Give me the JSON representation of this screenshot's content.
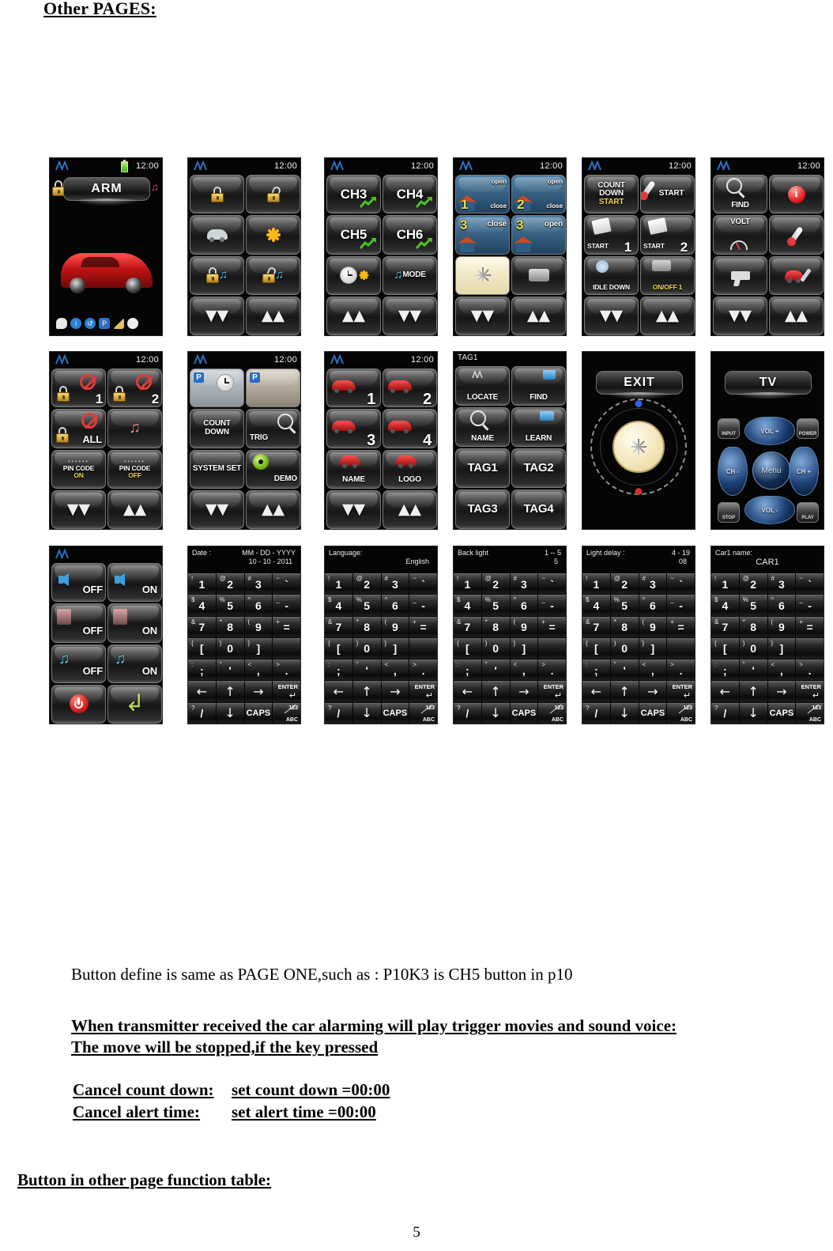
{
  "page": {
    "title": "Other PAGES:",
    "number": "5",
    "note_plain": "Button define is same as PAGE ONE,such as : P10K3 is CH5 button in p10",
    "bold_lines": [
      "When transmitter received the car alarming will play trigger movies and sound voice:",
      "The move will be stopped,if the key pressed"
    ],
    "cancel_rows": [
      {
        "left": "Cancel  count down:",
        "right": "set count down =00:00"
      },
      {
        "left": "Cancel  alert time:",
        "right": "set alert time  =00:00"
      }
    ],
    "footer_heading": "Button in other page function table:"
  },
  "common": {
    "clock": "12:00",
    "down_chevron": "❯",
    "up_chevron": "❮"
  },
  "screens": [
    {
      "id": "arm-home",
      "type": "home",
      "status": {
        "clock": "12:00",
        "battery": true,
        "signal": "signal-icon"
      },
      "banner": "ARM",
      "left_icon": "padlock-closed-icon",
      "right_icon": "music-note-icon",
      "car_image": "red-sports-car",
      "tray_icons": [
        "message-icon",
        "info-icon",
        "clock-icon",
        "parking-icon",
        "horn-icon",
        "alarm-clock-icon"
      ]
    },
    {
      "id": "lock-page",
      "type": "grid",
      "status": {
        "clock": "12:00"
      },
      "keys": [
        {
          "label": "",
          "icon": "padlock-closed-icon"
        },
        {
          "label": "",
          "icon": "padlock-open-icon"
        },
        {
          "label": "",
          "icon": "trunk-release-icon"
        },
        {
          "label": "",
          "icon": "flower-star-icon"
        },
        {
          "label": "",
          "icon": "lock-with-sound-icon"
        },
        {
          "label": "",
          "icon": "unlock-with-sound-icon"
        },
        {
          "label": "",
          "icon": "chevron-down-icon"
        },
        {
          "label": "",
          "icon": "chevron-up-icon"
        }
      ]
    },
    {
      "id": "channel-page",
      "type": "grid",
      "status": {
        "clock": "12:00"
      },
      "keys": [
        {
          "label": "CH3",
          "icon": "green-arrow-icon"
        },
        {
          "label": "CH4",
          "icon": "green-arrow-icon"
        },
        {
          "label": "CH5",
          "icon": "green-arrow-icon"
        },
        {
          "label": "CH6",
          "icon": "green-arrow-icon"
        },
        {
          "label": "",
          "icon": "clock-arrow-flower-icon"
        },
        {
          "label": "MODE",
          "icon": "music-mode-icon"
        },
        {
          "label": "",
          "icon": "chevron-up-icon"
        },
        {
          "label": "",
          "icon": "chevron-down-icon"
        }
      ]
    },
    {
      "id": "garage-page",
      "type": "grid",
      "status": {
        "clock": "12:00"
      },
      "keys": [
        {
          "label": "1",
          "label2": "open",
          "label3": "close",
          "icon": "garage-door-icon"
        },
        {
          "label": "2",
          "label2": "open",
          "label3": "close",
          "icon": "garage-door-icon"
        },
        {
          "label": "3",
          "label2": "close",
          "icon": "garage-close-icon"
        },
        {
          "label": "3",
          "label2": "open",
          "icon": "garage-open-icon"
        },
        {
          "label": "",
          "icon": "compass-star-icon"
        },
        {
          "label": "",
          "icon": "siren-icon"
        },
        {
          "label": "",
          "icon": "chevron-down-icon"
        },
        {
          "label": "",
          "icon": "chevron-up-icon"
        }
      ]
    },
    {
      "id": "start-page",
      "type": "grid",
      "status": {
        "clock": "12:00"
      },
      "keys": [
        {
          "label": "COUNT DOWN",
          "label_accent": "START",
          "icon": "countdown-icon"
        },
        {
          "label": "START",
          "icon": "thermometer-icon"
        },
        {
          "label": "START",
          "label_sub": "1",
          "icon": "calendar-12-icon"
        },
        {
          "label": "START",
          "label_sub": "2",
          "icon": "calendar-12-icon"
        },
        {
          "label": "IDLE DOWN",
          "icon": "gear-icon"
        },
        {
          "label_accent": "ON/OFF 1",
          "icon": "siren-icon"
        },
        {
          "label": "",
          "icon": "chevron-down-icon"
        },
        {
          "label": "",
          "icon": "chevron-up-icon"
        }
      ]
    },
    {
      "id": "find-page",
      "type": "grid",
      "status": {
        "clock": "12:00"
      },
      "keys": [
        {
          "label": "FIND",
          "icon": "magnifier-icon"
        },
        {
          "label": "",
          "icon": "info-circle-icon"
        },
        {
          "label": "VOLT",
          "icon": "gauge-icon"
        },
        {
          "label": "",
          "icon": "thermometer-icon"
        },
        {
          "label": "",
          "icon": "gun-icon"
        },
        {
          "label": "",
          "icon": "car-service-icon"
        },
        {
          "label": "",
          "icon": "chevron-down-icon"
        },
        {
          "label": "",
          "icon": "chevron-up-icon"
        }
      ]
    },
    {
      "id": "mute-page",
      "type": "grid",
      "status": {
        "clock": "12:00"
      },
      "keys": [
        {
          "label": "1",
          "icon": "lock-mute-icon"
        },
        {
          "label": "2",
          "icon": "lock-mute-icon"
        },
        {
          "label": "ALL",
          "icon": "lock-mute-icon"
        },
        {
          "label": "",
          "icon": "music-shake-icon"
        },
        {
          "label": "PIN CODE",
          "label_accent": "ON",
          "icon": "dots-icon"
        },
        {
          "label": "PIN CODE",
          "label_accent": "OFF",
          "icon": "dots-icon"
        },
        {
          "label": "",
          "icon": "chevron-down-icon"
        },
        {
          "label": "",
          "icon": "chevron-up-icon"
        }
      ]
    },
    {
      "id": "system-page",
      "type": "grid",
      "status": {
        "clock": "12:00"
      },
      "keys": [
        {
          "label": "",
          "icon": "parking-clock-icon"
        },
        {
          "label": "",
          "icon": "parking-book-icon"
        },
        {
          "label": "COUNT DOWN",
          "icon": ""
        },
        {
          "label": "TRIG",
          "icon": "magnifier-icon"
        },
        {
          "label": "SYSTEM SET",
          "icon": ""
        },
        {
          "label": "DEMO",
          "icon": "disc-icon"
        },
        {
          "label": "",
          "icon": "chevron-down-icon"
        },
        {
          "label": "",
          "icon": "chevron-up-icon"
        }
      ]
    },
    {
      "id": "car-select-page",
      "type": "grid",
      "status": {
        "clock": "12:00"
      },
      "keys": [
        {
          "label": "1",
          "icon": "red-car-icon"
        },
        {
          "label": "2",
          "icon": "red-car-icon"
        },
        {
          "label": "3",
          "icon": "red-car-icon"
        },
        {
          "label": "4",
          "icon": "red-car-icon"
        },
        {
          "label": "NAME",
          "icon": "red-car-icon"
        },
        {
          "label": "LOGO",
          "icon": "red-car-icon"
        },
        {
          "label": "",
          "icon": "chevron-down-icon"
        },
        {
          "label": "",
          "icon": "chevron-up-icon"
        }
      ]
    },
    {
      "id": "tag-page",
      "type": "grid",
      "title": "TAG1",
      "keys": [
        {
          "label": "LOCATE",
          "icon": "signal-icon"
        },
        {
          "label": "FIND",
          "icon": "map-icon"
        },
        {
          "label": "NAME",
          "icon": "magnifier-icon"
        },
        {
          "label": "LEARN",
          "icon": "map-icon"
        },
        {
          "label": "TAG1",
          "icon": ""
        },
        {
          "label": "TAG2",
          "icon": ""
        },
        {
          "label": "TAG3",
          "icon": ""
        },
        {
          "label": "TAG4",
          "icon": ""
        }
      ]
    },
    {
      "id": "compass-page",
      "type": "compass",
      "banner": "EXIT",
      "icon": "compass-rose-icon"
    },
    {
      "id": "tv-remote-page",
      "type": "tv",
      "banner": "TV",
      "buttons": [
        {
          "label": "VOL +",
          "name": "volume-up-button"
        },
        {
          "label": "VOL -",
          "name": "volume-down-button"
        },
        {
          "label": "CH -",
          "name": "channel-down-button"
        },
        {
          "label": "CH +",
          "name": "channel-up-button"
        },
        {
          "label": "Menu",
          "name": "menu-button"
        },
        {
          "label": "INPUT",
          "name": "input-button"
        },
        {
          "label": "POWER",
          "name": "power-button"
        },
        {
          "label": "STOP",
          "name": "stop-button"
        },
        {
          "label": "PLAY",
          "name": "play-button"
        }
      ]
    },
    {
      "id": "sound-page",
      "type": "grid",
      "status": {
        "clock": ""
      },
      "keys": [
        {
          "label": "OFF",
          "icon": "speaker-icon"
        },
        {
          "label": "ON",
          "icon": "speaker-icon"
        },
        {
          "label": "OFF",
          "icon": "vibrate-icon"
        },
        {
          "label": "ON",
          "icon": "vibrate-icon"
        },
        {
          "label": "OFF",
          "icon": "music-note-icon"
        },
        {
          "label": "ON",
          "icon": "music-note-icon"
        },
        {
          "label": "",
          "icon": "power-icon"
        },
        {
          "label": "",
          "icon": "enter-arrow-icon"
        }
      ]
    },
    {
      "id": "date-keypad",
      "type": "keypad",
      "head_label": "Date :",
      "head_value": "MM - DD - YYYY",
      "head_value2": "10 - 10 - 2011"
    },
    {
      "id": "language-keypad",
      "type": "keypad",
      "head_label": "Language:",
      "head_value": "",
      "head_value2": "English"
    },
    {
      "id": "backlight-keypad",
      "type": "keypad",
      "head_label": "Back light",
      "head_value": "1 -- 5",
      "head_value2": "5"
    },
    {
      "id": "lightdelay-keypad",
      "type": "keypad",
      "head_label": "Light delay :",
      "head_value": "4 - 19",
      "head_value2": "08"
    },
    {
      "id": "carname-keypad",
      "type": "keypad",
      "head_label": "Car1 name:",
      "head_center": "CAR1"
    }
  ],
  "keypad": {
    "rows": [
      [
        {
          "sup": "!",
          "main": "1"
        },
        {
          "sup": "@",
          "main": "2"
        },
        {
          "sup": "#",
          "main": "3"
        },
        {
          "sup": "~",
          "main": "`"
        }
      ],
      [
        {
          "sup": "$",
          "main": "4"
        },
        {
          "sup": "%",
          "main": "5"
        },
        {
          "sup": "^",
          "main": "6"
        },
        {
          "sup": "_",
          "main": "-"
        }
      ],
      [
        {
          "sup": "&",
          "main": "7"
        },
        {
          "sup": "*",
          "main": "8"
        },
        {
          "sup": "(",
          "main": "9"
        },
        {
          "sup": "+",
          "main": "="
        }
      ],
      [
        {
          "sup": "{",
          "main": "["
        },
        {
          "sup": ")",
          "main": "0"
        },
        {
          "sup": "}",
          "main": "]"
        },
        {
          "sup": "",
          "main": ""
        }
      ],
      [
        {
          "sup": ":",
          "main": ";"
        },
        {
          "sup": "\"",
          "main": "'"
        },
        {
          "sup": "<",
          "main": ","
        },
        {
          "sup": ">",
          "main": "."
        }
      ]
    ],
    "nav": [
      "←",
      "↑",
      "→"
    ],
    "enter_label": "ENTER",
    "enter_arrow": "↵",
    "bottom": {
      "sup": "?",
      "main": "/",
      "down": "↓",
      "caps": "CAPS",
      "num": "123",
      "abc": "ABC"
    }
  }
}
